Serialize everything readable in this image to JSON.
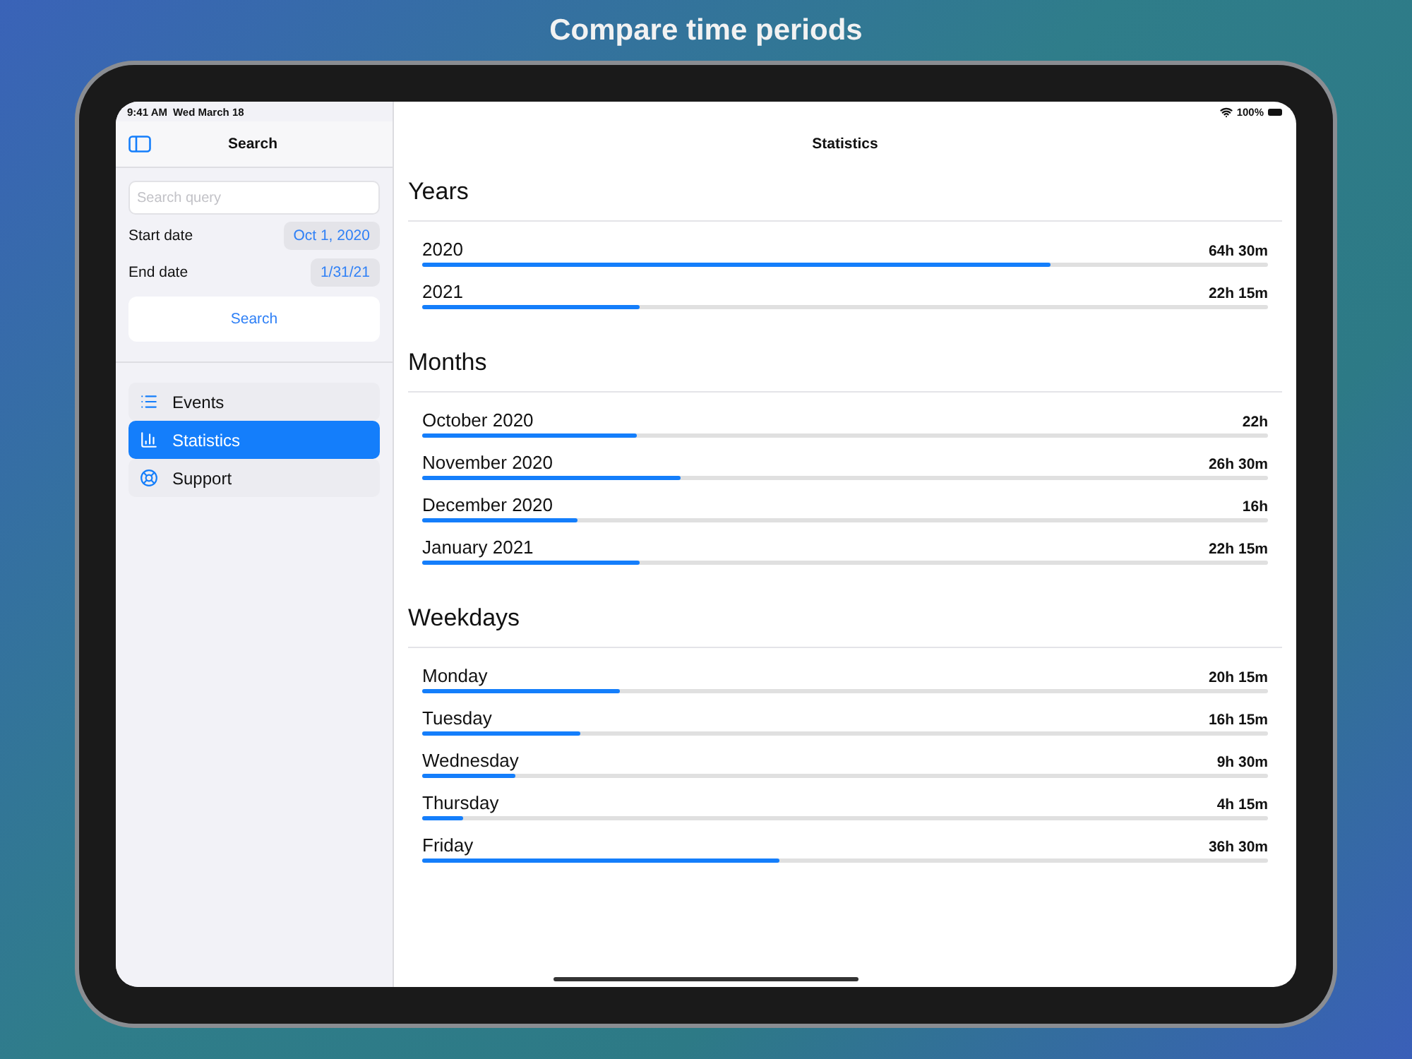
{
  "caption": "Compare time periods",
  "status_bar": {
    "time": "9:41 AM",
    "date": "Wed March 18",
    "battery": "100%"
  },
  "sidebar": {
    "title": "Search",
    "search": {
      "placeholder": "Search query"
    },
    "fields": [
      {
        "label": "Start date",
        "value": "Oct 1, 2020"
      },
      {
        "label": "End date",
        "value": "1/31/21"
      }
    ],
    "search_button": "Search",
    "items": [
      {
        "label": "Events",
        "kind": "list",
        "selected": false
      },
      {
        "label": "Statistics",
        "kind": "chart",
        "selected": true
      },
      {
        "label": "Support",
        "kind": "lifebuoy",
        "selected": false
      }
    ]
  },
  "content": {
    "title": "Statistics",
    "sections": [
      {
        "title": "Years",
        "rows": [
          {
            "label": "2020",
            "value": "64h 30m",
            "level": 0.743
          },
          {
            "label": "2021",
            "value": "22h 15m",
            "level": 0.257
          }
        ]
      },
      {
        "title": "Months",
        "rows": [
          {
            "label": "October 2020",
            "value": "22h",
            "level": 0.253
          },
          {
            "label": "November 2020",
            "value": "26h 30m",
            "level": 0.305
          },
          {
            "label": "December 2020",
            "value": "16h",
            "level": 0.183
          },
          {
            "label": "January 2021",
            "value": "22h 15m",
            "level": 0.257
          }
        ]
      },
      {
        "title": "Weekdays",
        "rows": [
          {
            "label": "Monday",
            "value": "20h 15m",
            "level": 0.233
          },
          {
            "label": "Tuesday",
            "value": "16h 15m",
            "level": 0.187
          },
          {
            "label": "Wednesday",
            "value": "9h 30m",
            "level": 0.11
          },
          {
            "label": "Thursday",
            "value": "4h 15m",
            "level": 0.048
          },
          {
            "label": "Friday",
            "value": "36h 30m",
            "level": 0.422
          }
        ]
      }
    ]
  }
}
